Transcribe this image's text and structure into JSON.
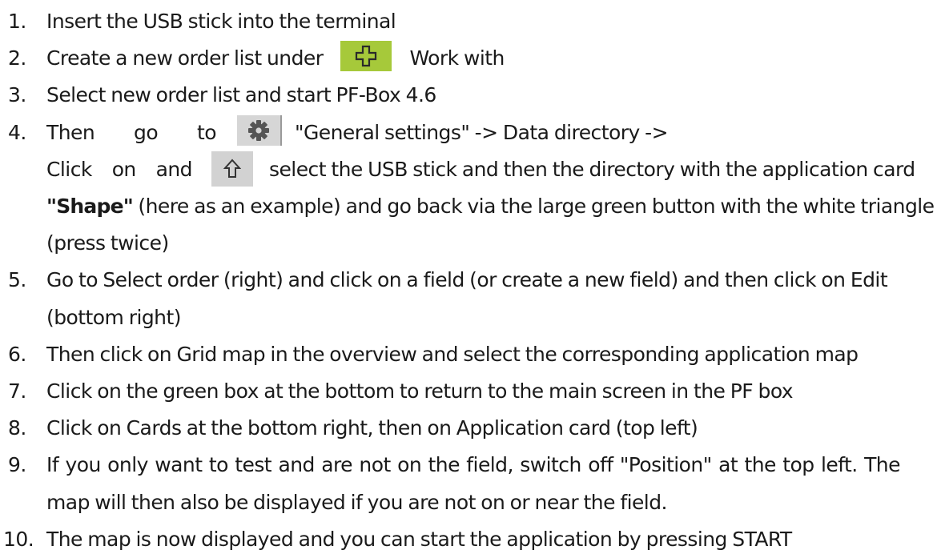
{
  "steps": [
    {
      "num": "1.",
      "text": "Insert the USB stick into the terminal"
    },
    {
      "num": "2.",
      "before": "Create a new order list under",
      "after": "Work with"
    },
    {
      "num": "3.",
      "text": "Select new order list and start PF-Box 4.6"
    },
    {
      "num": "4.",
      "l1": [
        "Then",
        "go",
        "to"
      ],
      "l1_after": "\"General settings\" -> Data directory ->",
      "l2": [
        "Click",
        "on",
        "and"
      ],
      "l2_after": "select the USB stick and then the directory with the application card",
      "l3_bold": "\"Shape\"",
      "l3_rest": "(here as an example) and go back via the large green button with the white triangle",
      "l4": "(press twice)"
    },
    {
      "num": "5.",
      "l1": "Go to Select order (right) and click on a field (or create a new field) and then click on Edit",
      "l2": "(bottom right)"
    },
    {
      "num": "6.",
      "text": "Then click on Grid map in the overview and select the corresponding application map"
    },
    {
      "num": "7.",
      "text": "Click on the green box at the bottom to return to the main screen in the PF box"
    },
    {
      "num": "8.",
      "text": "Click on Cards at the bottom right, then on Application card (top left)"
    },
    {
      "num": "9.",
      "l1": "If you only want to test and are not on the field, switch off \"Position\" at the top left.  The",
      "l2": "map will then also be displayed if you are not on or near the field."
    },
    {
      "num": "10.",
      "text": "The map is now displayed and you can start the application by pressing START"
    }
  ],
  "icons": {
    "plus": "plus-outline-icon",
    "gear": "gear-icon",
    "up": "up-arrow-icon"
  },
  "colors": {
    "plus_bg": "#a6c93a",
    "button_gray": "#d6d6d6"
  }
}
